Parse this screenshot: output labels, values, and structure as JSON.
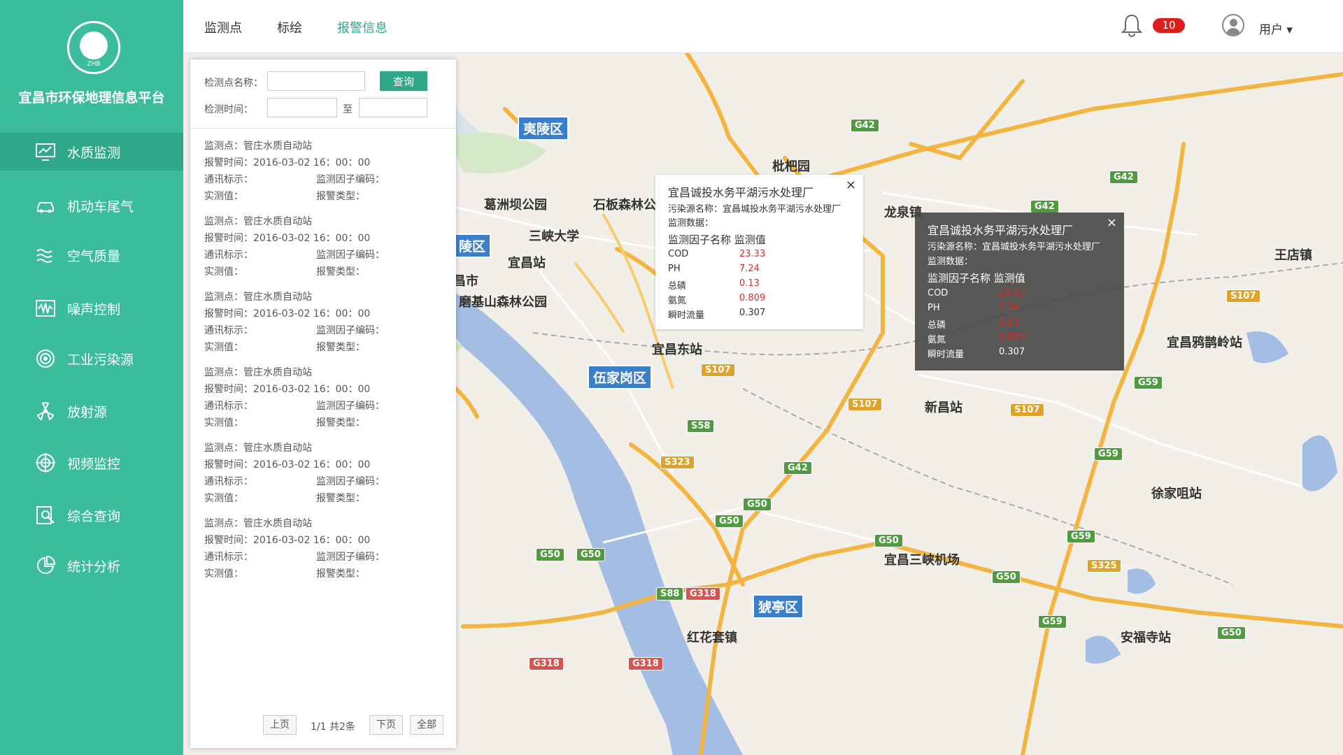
{
  "app": {
    "title": "宜昌市环保地理信息平台",
    "logo_caption": "ZHB"
  },
  "sidebar": {
    "items": [
      {
        "label": "水质监测",
        "icon": "water-monitor-icon",
        "active": true
      },
      {
        "label": "机动车尾气",
        "icon": "car-icon",
        "active": false
      },
      {
        "label": "空气质量",
        "icon": "wind-icon",
        "active": false
      },
      {
        "label": "噪声控制",
        "icon": "noise-wave-icon",
        "active": false
      },
      {
        "label": "工业污染源",
        "icon": "target-icon",
        "active": false
      },
      {
        "label": "放射源",
        "icon": "radiation-icon",
        "active": false
      },
      {
        "label": "视频监控",
        "icon": "camera-icon",
        "active": false
      },
      {
        "label": "综合查询",
        "icon": "search-doc-icon",
        "active": false
      },
      {
        "label": "统计分析",
        "icon": "pie-chart-icon",
        "active": false
      }
    ]
  },
  "header": {
    "tabs": [
      {
        "label": "监测点",
        "active": false
      },
      {
        "label": "标绘",
        "active": false
      },
      {
        "label": "报警信息",
        "active": true
      }
    ],
    "notification_count": "10",
    "user_label": "用户 ▾"
  },
  "panel": {
    "name_label": "检测点名称：",
    "name_value": "",
    "query_button": "查询",
    "time_label": "检测时间：",
    "time_from": "",
    "time_sep": "至",
    "time_to": "",
    "alarms": [
      {
        "point": "监测点：管庄水质自动站",
        "time": "报警时间：2016-03-02  16：00：00",
        "comm": "通讯标示：",
        "factor_code": "监测因子编码：",
        "value": "实测值：",
        "type": "报警类型："
      },
      {
        "point": "监测点：管庄水质自动站",
        "time": "报警时间：2016-03-02  16：00：00",
        "comm": "通讯标示：",
        "factor_code": "监测因子编码：",
        "value": "实测值：",
        "type": "报警类型："
      },
      {
        "point": "监测点：管庄水质自动站",
        "time": "报警时间：2016-03-02  16：00：00",
        "comm": "通讯标示：",
        "factor_code": "监测因子编码：",
        "value": "实测值：",
        "type": "报警类型："
      },
      {
        "point": "监测点：管庄水质自动站",
        "time": "报警时间：2016-03-02  16：00：00",
        "comm": "通讯标示：",
        "factor_code": "监测因子编码：",
        "value": "实测值：",
        "type": "报警类型："
      },
      {
        "point": "监测点：管庄水质自动站",
        "time": "报警时间：2016-03-02  16：00：00",
        "comm": "通讯标示：",
        "factor_code": "监测因子编码：",
        "value": "实测值：",
        "type": "报警类型："
      },
      {
        "point": "监测点：管庄水质自动站",
        "time": "报警时间：2016-03-02  16：00：00",
        "comm": "通讯标示：",
        "factor_code": "监测因子编码：",
        "value": "实测值：",
        "type": "报警类型："
      }
    ],
    "pagination": {
      "prev": "上页",
      "info": "1/1 共2条",
      "next": "下页",
      "all": "全部"
    }
  },
  "popups": [
    {
      "title": "宜昌诚投水务平湖污水处理厂",
      "source_line": "污染源名称：宜昌城投水务平湖污水处理厂",
      "data_line": "监测数据：",
      "header": "监测因子名称 监测值",
      "rows": [
        {
          "name": "COD",
          "value": "23.33",
          "alert": true
        },
        {
          "name": "PH",
          "value": "7.24",
          "alert": true
        },
        {
          "name": "总磷",
          "value": "0.13",
          "alert": true
        },
        {
          "name": "氨氮",
          "value": "0.809",
          "alert": true
        },
        {
          "name": "瞬时流量",
          "value": "0.307",
          "alert": false
        }
      ]
    },
    {
      "title": "宜昌诚投水务平湖污水处理厂",
      "source_line": "污染源名称：宜昌城投水务平湖污水处理厂",
      "data_line": "监测数据：",
      "header": "监测因子名称 监测值",
      "rows": [
        {
          "name": "COD",
          "value": "23.33",
          "alert": true
        },
        {
          "name": "PH",
          "value": "7.24",
          "alert": true
        },
        {
          "name": "总磷",
          "value": "0.13",
          "alert": true
        },
        {
          "name": "氨氮",
          "value": "0.809",
          "alert": true
        },
        {
          "name": "瞬时流量",
          "value": "0.307",
          "alert": false
        }
      ]
    }
  ],
  "map": {
    "place_labels": [
      "夷陵区",
      "枇杷园",
      "龙泉镇",
      "王店镇",
      "葛洲坝公园",
      "石板森林公",
      "三峡大学",
      "陵区",
      "宜昌站",
      "昌市",
      "磨基山森林公园",
      "宜昌东站",
      "伍家岗区",
      "新昌站",
      "宜昌鸦鹊岭站",
      "徐家咀站",
      "宜昌三峡机场",
      "猇亭区",
      "红花套镇",
      "安福寺站"
    ],
    "route_shields": [
      "G42",
      "G42",
      "G42",
      "G42",
      "S107",
      "S107",
      "S107",
      "S107",
      "G59",
      "G59",
      "G59",
      "G59",
      "S58",
      "S323",
      "G50",
      "G50",
      "G50",
      "G50",
      "G50",
      "G50",
      "G50",
      "S325",
      "S88",
      "G318",
      "G318",
      "G318"
    ],
    "colors": {
      "land": "#f1efe8",
      "water": "#a3bde3",
      "highway": "#f3b53f",
      "road": "#ffffff"
    }
  }
}
